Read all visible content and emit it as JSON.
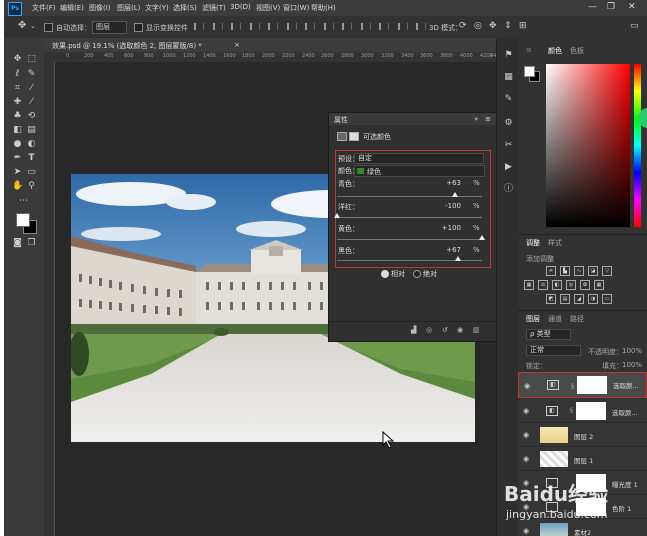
{
  "colors": {
    "app_bg": "#282828",
    "panel_bg": "#323232",
    "highlight": "#c0392b",
    "accent_blue": "#31a8ff",
    "green_swatch": "#2d8a2d"
  },
  "app": {
    "logo": "Ps"
  },
  "menu": [
    "文件(F)",
    "编辑(E)",
    "图像(I)",
    "图层(L)",
    "文字(Y)",
    "选择(S)",
    "滤镜(T)",
    "3D(D)",
    "视图(V)",
    "窗口(W)",
    "帮助(H)"
  ],
  "window_controls": {
    "minimize": "—",
    "restore": "❐",
    "close": "✕"
  },
  "options_bar": {
    "move_icon": "✥",
    "auto_select_label": "自动选择：",
    "auto_select_value": "图层",
    "transform_label": "显示变换控件",
    "mode_label": "3D 模式："
  },
  "doc_tab": {
    "title": "效果.psd @ 19.1% (选取颜色 2, 图层蒙版/8) *",
    "close": "×"
  },
  "ruler_ticks": [
    "0",
    "200",
    "400",
    "600",
    "800",
    "1000",
    "1200",
    "1400",
    "1600",
    "1800",
    "2000",
    "2200",
    "2400",
    "2600",
    "2800",
    "3000",
    "3200",
    "3400",
    "3600",
    "3800",
    "4000",
    "4200",
    "44"
  ],
  "properties": {
    "header": "属性",
    "collapse": "»",
    "menu": "≡",
    "title": "可选颜色",
    "preset_label": "预设：",
    "preset_value": "自定",
    "colors_label": "颜色：",
    "colors_value": "绿色",
    "sliders": [
      {
        "label": "青色：",
        "value": "+63",
        "unit": "%",
        "level": 0.815
      },
      {
        "label": "洋红：",
        "value": "-100",
        "unit": "%",
        "level": 0.0
      },
      {
        "label": "黄色：",
        "value": "+100",
        "unit": "%",
        "level": 1.0
      },
      {
        "label": "黑色：",
        "value": "+67",
        "unit": "%",
        "level": 0.835
      }
    ],
    "method_relative": "相对",
    "method_absolute": "绝对",
    "footer_icons": [
      "clip",
      "view-previous",
      "reset",
      "visibility",
      "delete"
    ]
  },
  "color_panel": {
    "tabs": [
      "颜色",
      "色板"
    ]
  },
  "adjust_panel": {
    "tabs": [
      "调整",
      "样式"
    ],
    "add_label": "添加调整"
  },
  "layers_panel": {
    "tabs": [
      "图层",
      "通道",
      "路径"
    ],
    "kind_label": "ρ 类型",
    "blend_mode": "正常",
    "opacity_label": "不透明度：",
    "opacity_value": "100%",
    "lock_label": "锁定：",
    "fill_label": "填充：",
    "fill_value": "100%",
    "layers": [
      {
        "name": "选取颜...",
        "selected": true,
        "has_mask": true
      },
      {
        "name": "选取颜...",
        "selected": false,
        "has_mask": true
      },
      {
        "name": "图层 2",
        "selected": false,
        "has_mask": false
      },
      {
        "name": "图层 1",
        "selected": false,
        "has_mask": false
      },
      {
        "name": "曝光度 1",
        "selected": false,
        "has_mask": true
      },
      {
        "name": "色阶 1",
        "selected": false,
        "has_mask": true
      },
      {
        "name": "素材2",
        "selected": false,
        "has_mask": false
      }
    ]
  },
  "watermark": {
    "brand": "Baidu经验",
    "url": "jingyan.baidu.com"
  }
}
